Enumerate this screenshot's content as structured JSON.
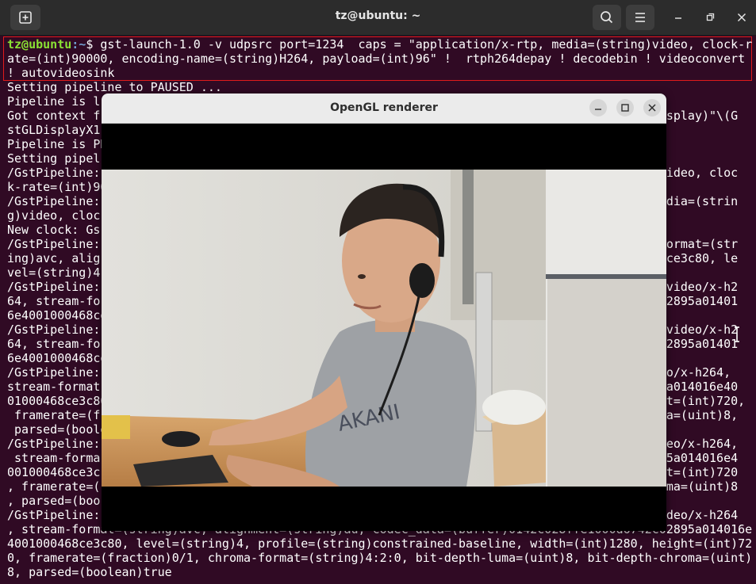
{
  "window": {
    "title": "tz@ubuntu: ~"
  },
  "terminal": {
    "prompt_user": "tz@ubuntu",
    "prompt_path": ":~",
    "prompt_sign": "$ ",
    "command_first_line": "gst-launch-1.0 -v udpsrc port=1234  caps = \"application/x-rtp, media=(string)video, clock-r",
    "lines": [
      "ate=(int)90000, encoding-name=(string)H264, payload=(int)96\" !  rtph264depay ! decodebin ! videoconvert",
      "! autovideosink",
      "Setting pipeline to PAUSED ...",
      "Pipeline is l                                                                                       ",
      "Got context f                                                                             Display)\"\\(G",
      "stGLDisplayX1",
      "Pipeline is PR",
      "Setting pipel",
      "/GstPipeline:                                                                             )video, cloc",
      "k-rate=(int)90",
      "/GstPipeline:                                                                             media=(strin",
      "g)video, cloc",
      "New clock: Gs",
      "/GstPipeline:                                                                             -format=(str",
      "ing)avc, alig                                                                             58ce3c80, le",
      "vel=(string)4",
      "/GstPipeline:                                                                             = video/x-h2",
      "64, stream-fo                                                                             402895a01401",
      "6e4001000468ce",
      "/GstPipeline:                                                                             = video/x-h2",
      "64, stream-fo                                                                             402895a01401",
      "6e4001000468ce",
      "/GstPipeline:                                                                             deo/x-h264,",
      "stream-format                                                                             95a014016e40",
      "01000468ce3c80                                                                            ght=(int)720,",
      " framerate=(f                                                                             oma=(uint)8,",
      " parsed=(boole",
      "/GstPipeline:                                                                             ideo/x-h264,",
      " stream-forma                                                                             895a014016e4",
      "001000468ce3c                                                                             ght=(int)720",
      ", framerate=(                                                                             roma=(uint)8",
      ", parsed=(boo",
      "/GstPipeline:                                                                             video/x-h264",
      ", stream-format=(string)avc, alignment=(string)au, codec_data=(buffer)0142c028ffe1000d6742c02895a014016e",
      "4001000468ce3c80, level=(string)4, profile=(string)constrained-baseline, width=(int)1280, height=(int)72",
      "0, framerate=(fraction)0/1, chroma-format=(string)4:2:0, bit-depth-luma=(uint)8, bit-depth-chroma=(uint)",
      "8, parsed=(boolean)true"
    ]
  },
  "renderer": {
    "title": "OpenGL renderer"
  },
  "icons": {
    "new_tab": "new-tab-icon",
    "search": "search-icon",
    "menu": "hamburger-menu-icon",
    "minimize": "minimize-icon",
    "maximize": "maximize-icon",
    "close": "close-icon"
  },
  "colors": {
    "terminal_bg": "#300a24",
    "prompt_user": "#8ae234",
    "prompt_path": "#729fcf",
    "highlight_box": "#e01b1b"
  }
}
